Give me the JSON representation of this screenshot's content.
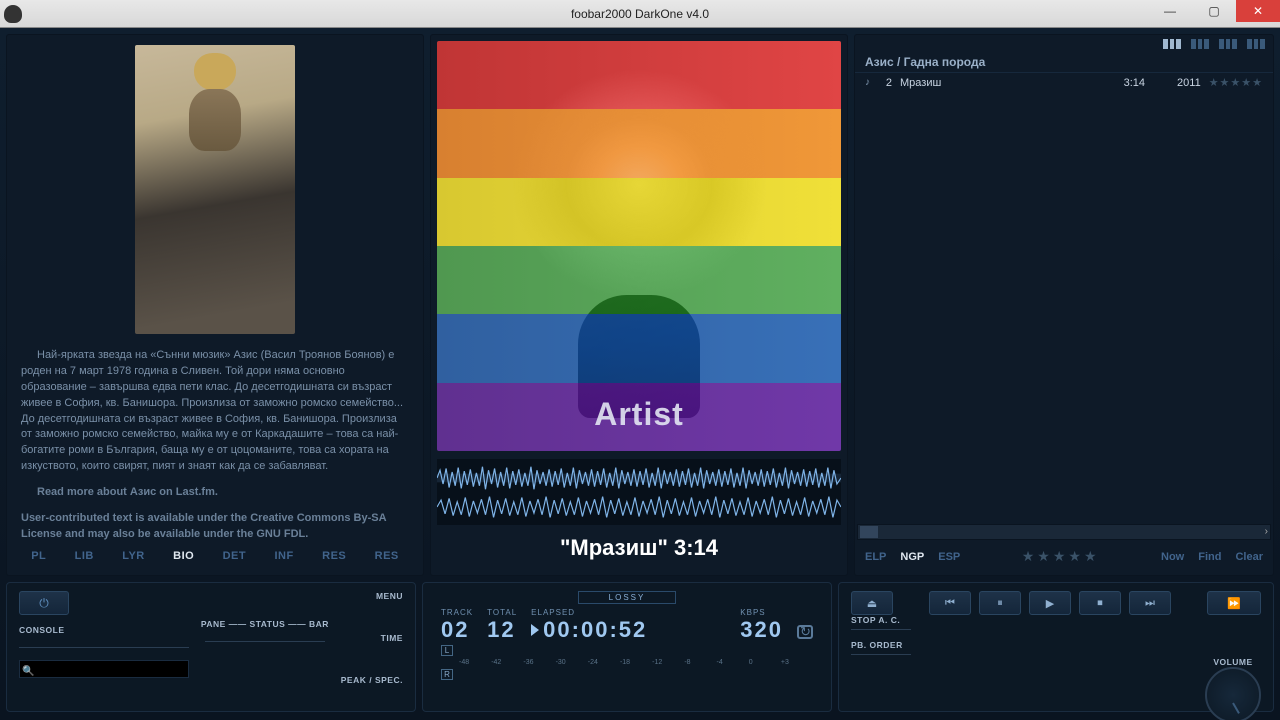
{
  "window": {
    "title": "foobar2000 DarkOne v4.0"
  },
  "bio": {
    "p1": "Най-ярката звезда на «Сънни мюзик» Азис (Васил Троянов Боянов) е роден на 7 март 1978 година в Сливен. Той дори няма основно образование – завършва едва пети клас. До десетгодишната си възраст живее в София, кв. Банишора. Произлиза от заможно ромско семейство... До десетгодишната си възраст живее в София, кв. Банишора. Произлиза от заможно ромско семейство, майка му е от Каркадашите – това са най- богатите роми в България, баща му е от цоцоманите, това са хората на изкуството, които свирят, пият и знаят как да се забавляват.",
    "more": "Read more about Азис on Last.fm.",
    "cc": "User-contributed text is available under the Creative Commons By-SA License and may also be available under the GNU FDL."
  },
  "left_tabs": {
    "pl": "PL",
    "lib": "LIB",
    "lyr": "LYR",
    "bio": "BIO",
    "det": "DET",
    "inf": "INF",
    "res1": "RES",
    "res2": "RES"
  },
  "art": {
    "overlay": "Artist"
  },
  "nowplaying": "\"Мразиш\" 3:14",
  "playlist": {
    "header": "Азис / Гадна порода",
    "rows": [
      {
        "n": "2",
        "title": "Мразиш",
        "len": "3:14",
        "year": "2011"
      }
    ]
  },
  "right_bottom": {
    "elp": "ELP",
    "ngp": "NGP",
    "esp": "ESP",
    "now": "Now",
    "find": "Find",
    "clear": "Clear"
  },
  "controls": {
    "console": "CONSOLE",
    "pane": "PANE",
    "status": "STATUS",
    "bar": "BAR",
    "menu": "MENU",
    "time": "TIME",
    "peak": "PEAK / SPEC."
  },
  "display": {
    "lossy": "LOSSY",
    "track_l": "TRACK",
    "track_v": "02",
    "total_l": "TOTAL",
    "total_v": "12",
    "elapsed_l": "ELAPSED",
    "elapsed_v": "00:00:52",
    "kbps_l": "KBPS",
    "kbps_v": "320",
    "L": "L",
    "R": "R",
    "ticks": [
      "-48",
      "-42",
      "-36",
      "-30",
      "-24",
      "-18",
      "-12",
      "-8",
      "-4",
      "0",
      "+3"
    ]
  },
  "lp3": {
    "stopac": "STOP A. C.",
    "pborder": "PB. ORDER",
    "volume": "VOLUME"
  }
}
